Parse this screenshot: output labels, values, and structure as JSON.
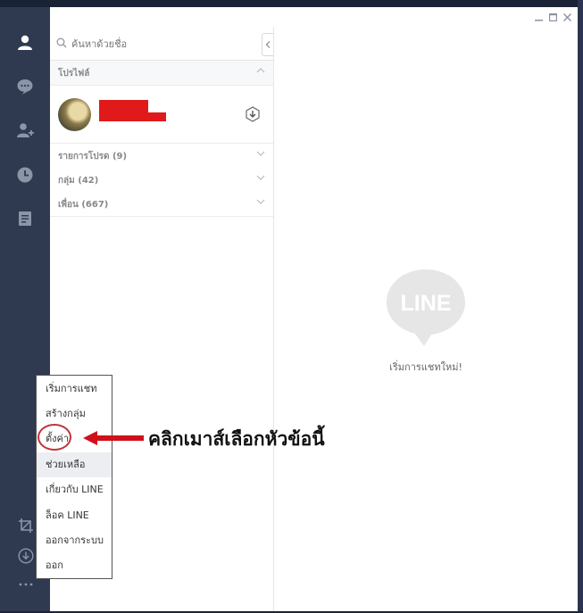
{
  "search": {
    "placeholder": "ค้นหาด้วยชื่อ"
  },
  "sections": {
    "profile": "โปรไฟล์",
    "favorites": "รายการโปรด (9)",
    "groups": "กลุ่ม (42)",
    "friends": "เพื่อน (667)"
  },
  "profile": {
    "name_redacted": ""
  },
  "chat": {
    "logo": "LINE",
    "start_text": "เริ่มการแชทใหม่!"
  },
  "menu": {
    "items": [
      "เริ่มการแชท",
      "สร้างกลุ่ม",
      "ตั้งค่า",
      "ช่วยเหลือ",
      "เกี่ยวกับ LINE",
      "ล็อค LINE",
      "ออกจากระบบ",
      "ออก"
    ]
  },
  "annotation": {
    "text": "คลิกเมาส์เลือกหัวข้อนี้"
  },
  "colors": {
    "sidebar": "#2f3a50",
    "annotation_red": "#d0101a",
    "line_gray": "#e6e6e6"
  },
  "icons": {
    "sidebar": [
      "person-icon",
      "chat-bubble-icon",
      "add-friend-icon",
      "clock-icon",
      "note-icon"
    ],
    "sidebar_bottom": [
      "crop-icon",
      "download-circle-icon",
      "more-dots-icon"
    ]
  }
}
